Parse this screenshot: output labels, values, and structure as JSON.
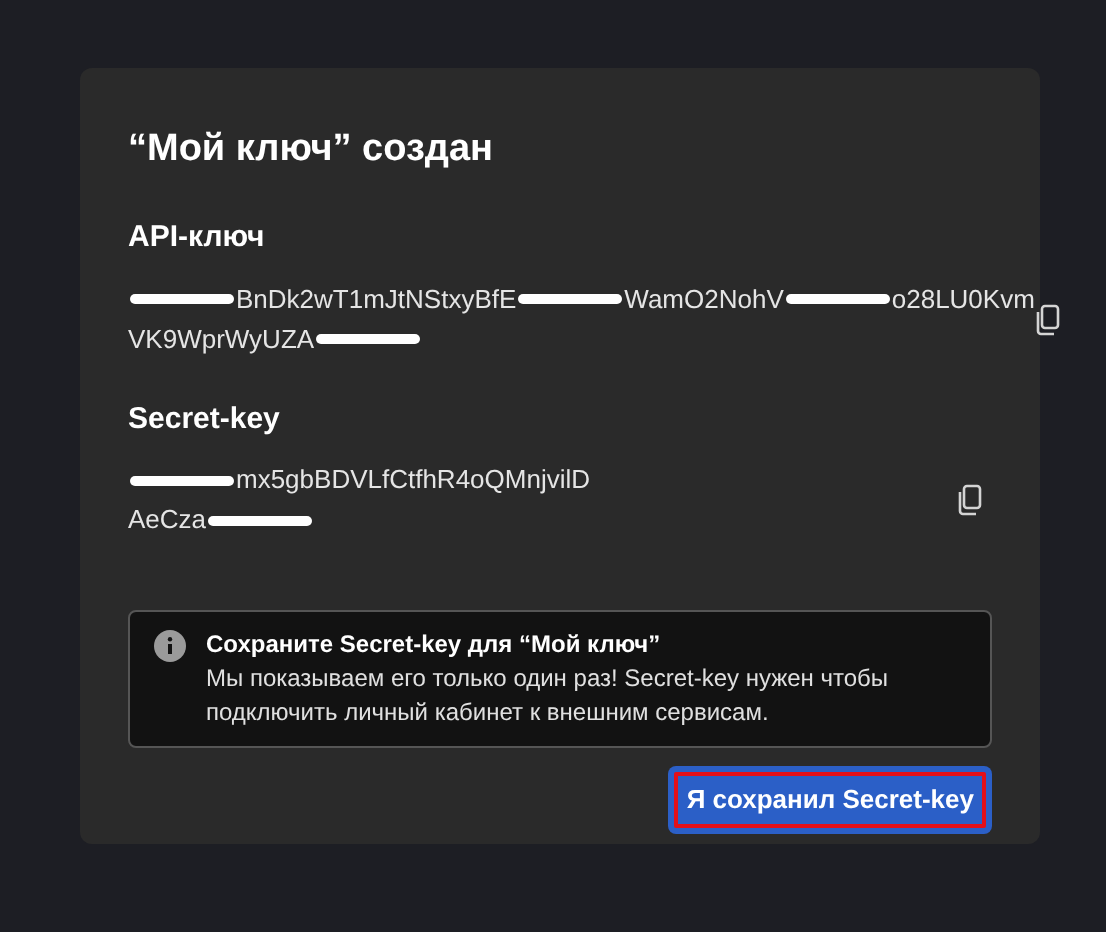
{
  "dialog": {
    "title": "“Мой ключ” создан",
    "fields": [
      {
        "label": "API-ключ",
        "lines": [
          [
            {
              "kind": "redacted"
            },
            {
              "kind": "text",
              "text": "BnDk2wT1mJtNStxyBfE"
            },
            {
              "kind": "redacted"
            },
            {
              "kind": "text",
              "text": "WamO2NohV"
            },
            {
              "kind": "redacted"
            },
            {
              "kind": "text",
              "text": "o28LU0Kvm"
            }
          ],
          [
            {
              "kind": "text",
              "text": "VK9WprWyUZA"
            },
            {
              "kind": "redacted"
            }
          ]
        ]
      },
      {
        "label": "Secret-key",
        "lines": [
          [
            {
              "kind": "redacted"
            },
            {
              "kind": "text",
              "text": "mx5gbBDVLfCtfhR4oQMnjvilD"
            }
          ],
          [
            {
              "kind": "text",
              "text": "AeCza"
            },
            {
              "kind": "redacted"
            }
          ]
        ]
      }
    ],
    "notice": {
      "title": "Сохраните Secret-key для “Мой ключ”",
      "body": "Мы показываем его только один раз! Secret-key нужен чтобы подключить личный кабинет к внешним сервисам."
    },
    "confirm_button": {
      "label": "Я сохранил Secret-key",
      "highlighted": true
    }
  }
}
